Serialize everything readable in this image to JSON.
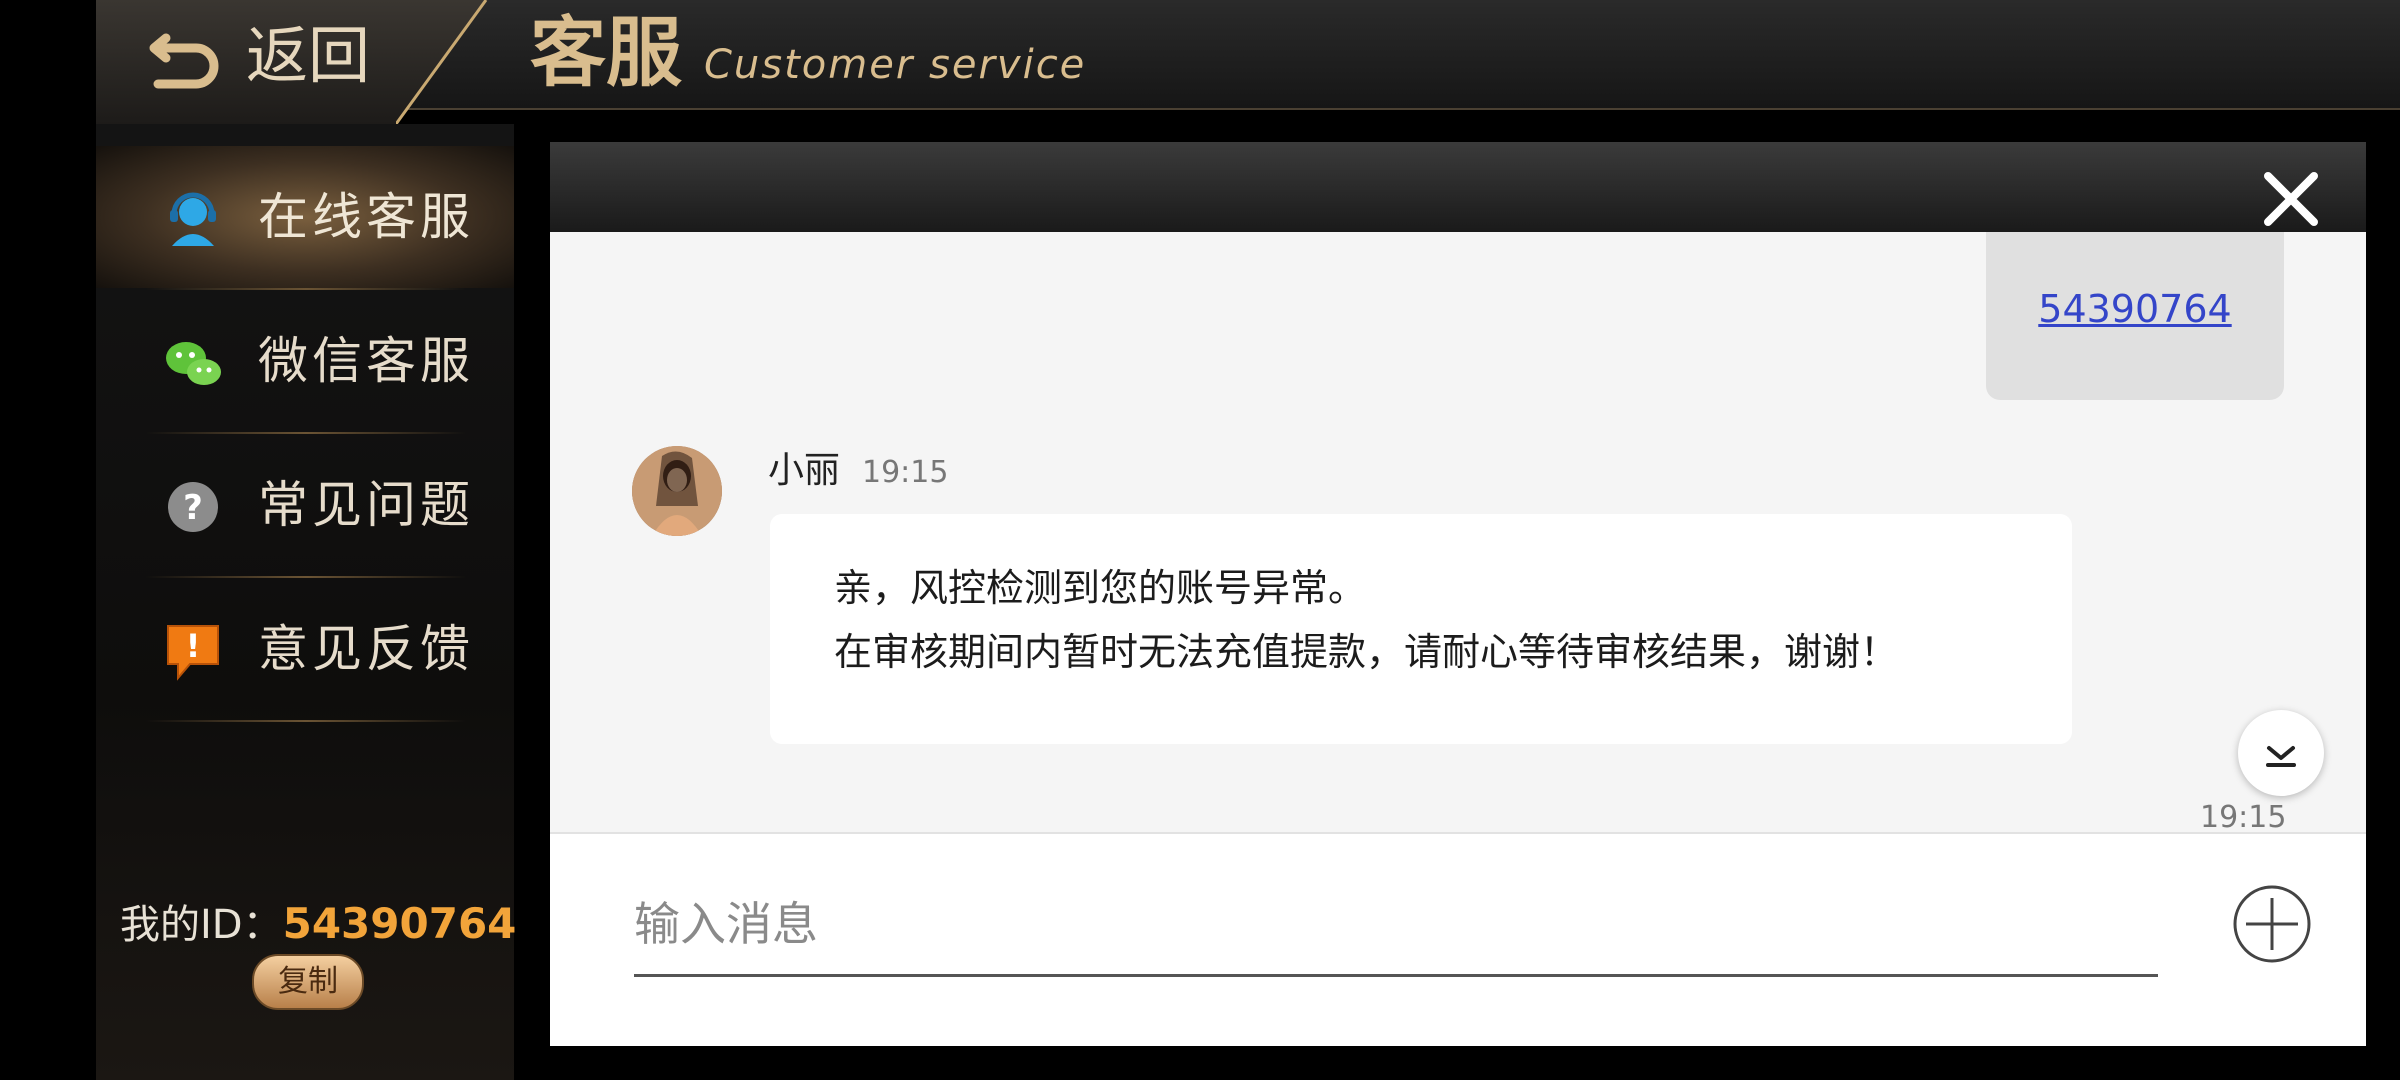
{
  "header": {
    "back_label": "返回",
    "title_cn": "客服",
    "title_en": "Customer service"
  },
  "sidebar": {
    "items": [
      {
        "label": "在线客服",
        "icon": "customer-service-agent-icon",
        "active": true
      },
      {
        "label": "微信客服",
        "icon": "wechat-icon",
        "active": false
      },
      {
        "label": "常见问题",
        "icon": "question-icon",
        "active": false
      },
      {
        "label": "意见反馈",
        "icon": "feedback-icon",
        "active": false
      }
    ],
    "my_id_label": "我的ID：",
    "my_id_value": "54390764",
    "copy_label": "复制"
  },
  "chat": {
    "sent_message": "54390764",
    "agent_name": "小丽",
    "agent_time": "19:15",
    "agent_message_lines": [
      "亲，风控检测到您的账号异常。",
      "在审核期间内暂时无法充值提款，请耐心等待审核结果，谢谢！"
    ],
    "bottom_time": "19:15"
  },
  "input": {
    "placeholder": "输入消息"
  },
  "colors": {
    "accent_gold": "#d9bd8e",
    "id_orange": "#f2a43a",
    "link_blue": "#3445c9"
  }
}
